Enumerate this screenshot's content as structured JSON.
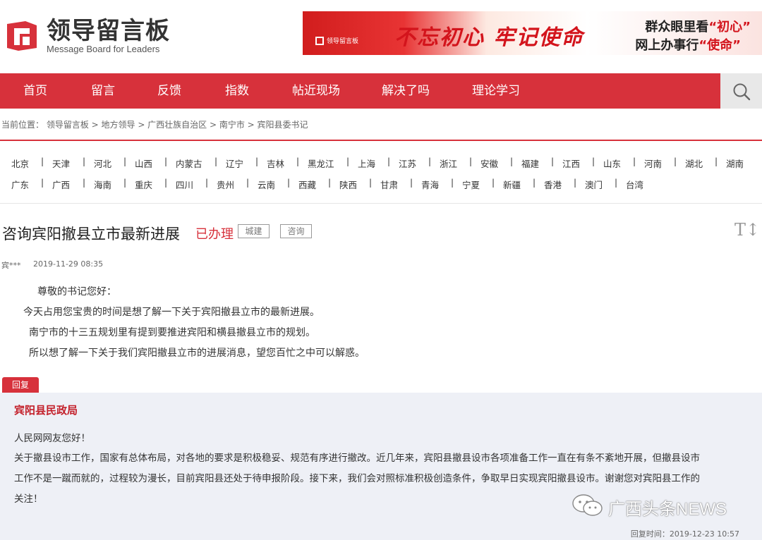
{
  "header": {
    "logo_title": "领导留言板",
    "logo_subtitle": "Message Board for Leaders",
    "banner": {
      "badge": "领导留言板",
      "slogan": "不忘初心 牢记使命",
      "line1_prefix": "群众眼里看",
      "line1_highlight": "“初心”",
      "line2_prefix": "网上办事行",
      "line2_highlight": "“使命”"
    }
  },
  "nav": {
    "items": [
      "首页",
      "留言",
      "反馈",
      "指数",
      "帖近现场",
      "解决了吗",
      "理论学习"
    ],
    "search_icon": "search-icon"
  },
  "breadcrumb": "当前位置： 领导留言板 > 地方领导 > 广西壮族自治区 > 南宁市 > 宾阳县委书记",
  "regions": {
    "row1": [
      "北京",
      "天津",
      "河北",
      "山西",
      "内蒙古",
      "辽宁",
      "吉林",
      "黑龙江",
      "上海",
      "江苏",
      "浙江",
      "安徽",
      "福建",
      "江西",
      "山东",
      "河南",
      "湖北",
      "湖南"
    ],
    "row2": [
      "广东",
      "广西",
      "海南",
      "重庆",
      "四川",
      "贵州",
      "云南",
      "西藏",
      "陕西",
      "甘肃",
      "青海",
      "宁夏",
      "新疆",
      "香港",
      "澳门",
      "台湾"
    ],
    "separator": "|"
  },
  "post": {
    "title": "咨询宾阳撤县立市最新进展",
    "status": "已办理",
    "tags": [
      "城建",
      "咨询"
    ],
    "font_toggle": "T↕",
    "author": "宾***",
    "time": "2019-11-29 08:35",
    "body": [
      "尊敬的书记您好：",
      "今天占用您宝贵的时间是想了解一下关于宾阳撤县立市的最新进展。",
      "南宁市的十三五规划里有提到要推进宾阳和横县撤县立市的规划。",
      "所以想了解一下关于我们宾阳撤县立市的进展消息，望您百忙之中可以解惑。"
    ]
  },
  "reply": {
    "tab_label": "回复",
    "org": "宾阳县民政局",
    "lines": [
      "人民网网友您好！",
      "关于撤县设市工作，国家有总体布局，对各地的要求是积极稳妥、规范有序进行撤改。近几年来，宾阳县撤县设市各项准备工作一直在有条不紊地开展，但撤县设市",
      "工作不是一蹴而就的，过程较为漫长，目前宾阳县还处于待申报阶段。接下来，我们会对照标准积极创造条件，争取早日实现宾阳撤县设市。谢谢您对宾阳县工作的",
      "关注！"
    ],
    "time": "回复时间：2019-12-23 10:57"
  },
  "watermark": "广西头条NEWS",
  "colors": {
    "brand_red": "#d7313b",
    "reply_bg": "#eef0f6"
  }
}
